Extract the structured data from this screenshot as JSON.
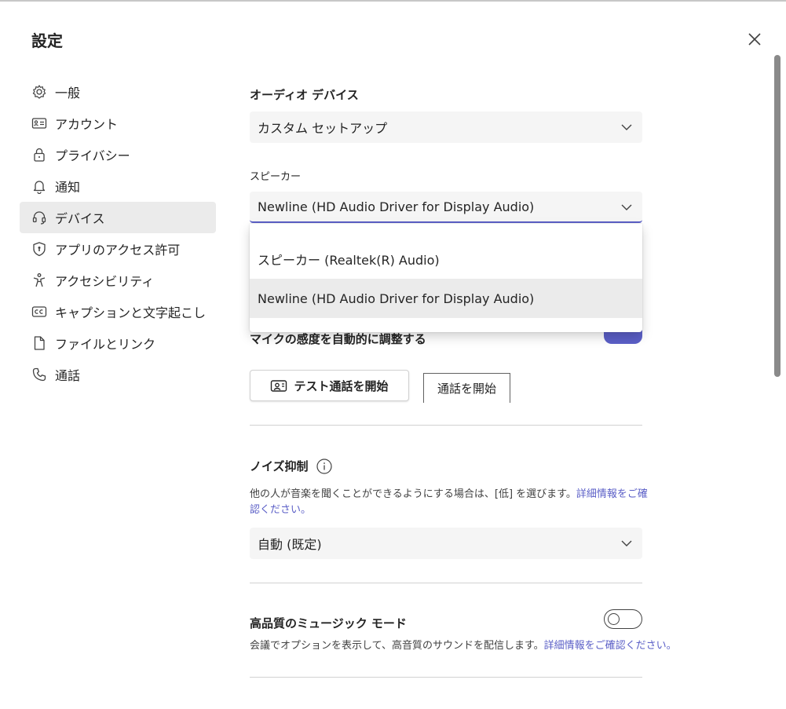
{
  "dialog": {
    "title": "設定"
  },
  "nav": {
    "items": [
      {
        "label": "一般",
        "icon": "gear-icon"
      },
      {
        "label": "アカウント",
        "icon": "id-card-icon"
      },
      {
        "label": "プライバシー",
        "icon": "lock-icon"
      },
      {
        "label": "通知",
        "icon": "bell-icon"
      },
      {
        "label": "デバイス",
        "icon": "headset-icon",
        "active": true
      },
      {
        "label": "アプリのアクセス許可",
        "icon": "shield-icon"
      },
      {
        "label": "アクセシビリティ",
        "icon": "accessibility-icon"
      },
      {
        "label": "キャプションと文字起こし",
        "icon": "cc-icon"
      },
      {
        "label": "ファイルとリンク",
        "icon": "file-icon"
      },
      {
        "label": "通話",
        "icon": "phone-icon"
      }
    ]
  },
  "audio": {
    "heading": "オーディオ デバイス",
    "device_value": "カスタム セットアップ",
    "speaker_label": "スピーカー",
    "speaker_value": "Newline (HD Audio Driver for Display Audio)",
    "speaker_options": [
      "スピーカー (Realtek(R) Audio)",
      "Newline (HD Audio Driver for Display Audio)"
    ],
    "mic_auto_label": "マイクの感度を自動的に調整する",
    "mic_auto_on": true,
    "test_call_button": "テスト通話を開始",
    "start_call_button": "通話を開始"
  },
  "noise": {
    "heading": "ノイズ抑制",
    "desc": "他の人が音楽を聞くことができるようにする場合は、[低] を選びます。",
    "desc_link_line1": "詳細情報をご確",
    "desc_link_line2": "認ください。",
    "value": "自動 (既定)"
  },
  "music": {
    "heading": "高品質のミュージック モード",
    "desc": "会議でオプションを表示して、高音質のサウンドを配信します。",
    "desc_link": "詳細情報をご確認ください。",
    "toggle_on": false
  },
  "colors": {
    "accent": "#5b5fc7",
    "selected_bg": "#ebebeb",
    "field_bg": "#f5f5f5"
  }
}
